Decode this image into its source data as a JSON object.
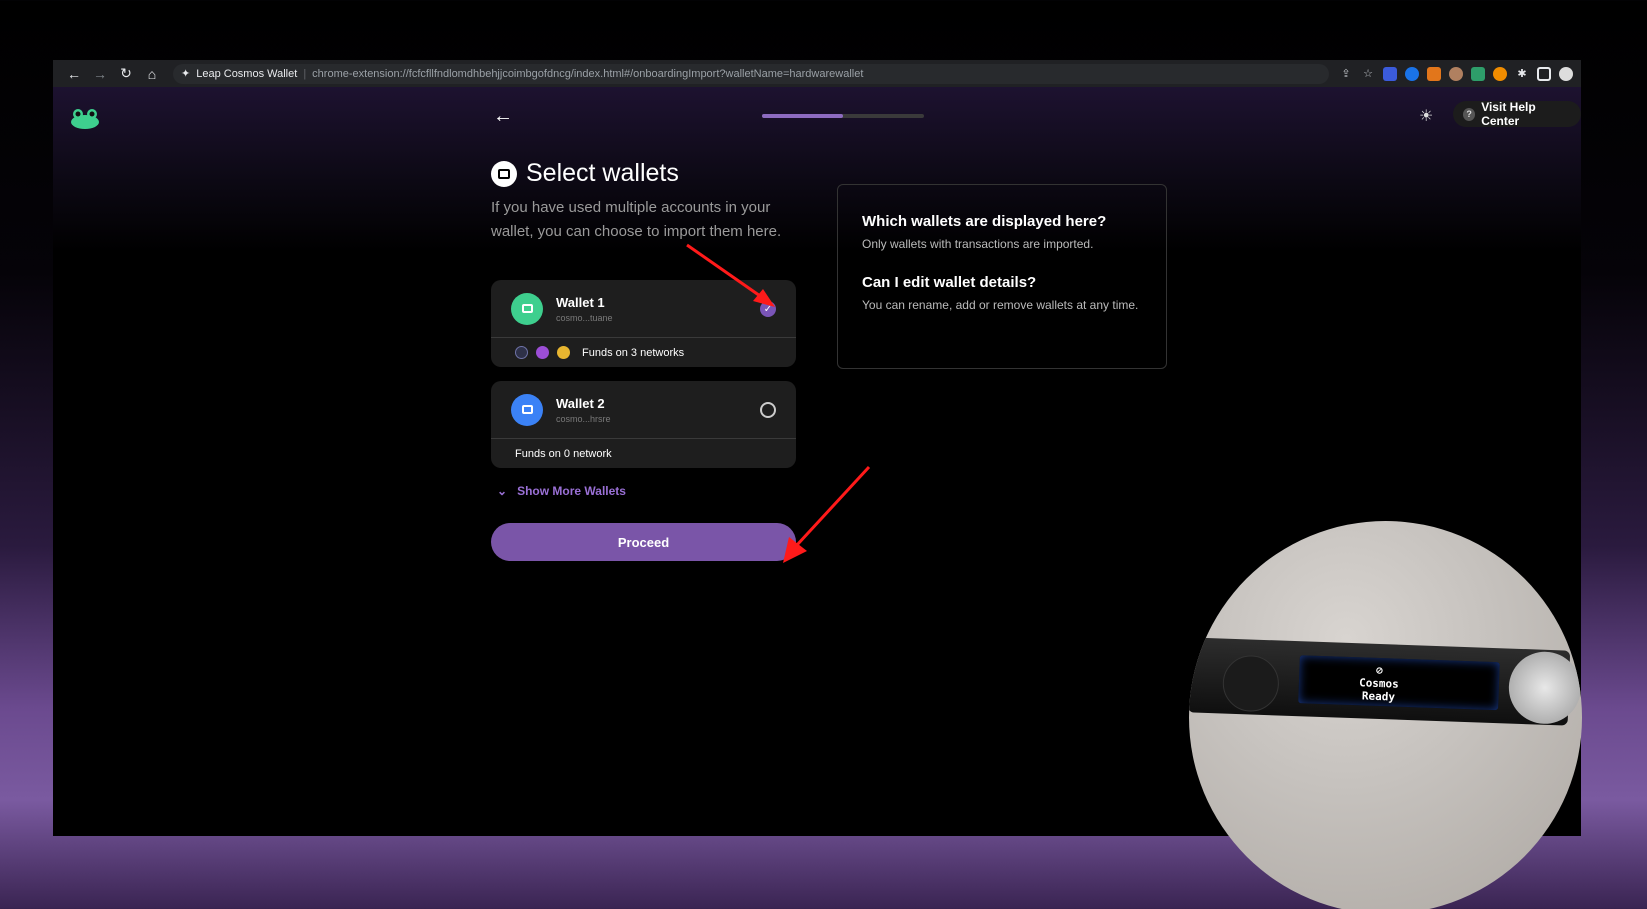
{
  "browser": {
    "site_name": "Leap Cosmos Wallet",
    "url": "chrome-extension://fcfcfllfndlomdhbehjjcoimbgofdncg/index.html#/onboardingImport?walletName=hardwarewallet"
  },
  "header": {
    "help_label": "Visit Help Center",
    "progress": 0.5
  },
  "main": {
    "title": "Select wallets",
    "subtitle": "If you have used multiple accounts in your wallet, you can choose to import them here.",
    "wallets": [
      {
        "name": "Wallet 1",
        "address": "cosmo...tuane",
        "funds": "Funds on 3 networks",
        "selected": true,
        "color": "#3ecf8e"
      },
      {
        "name": "Wallet 2",
        "address": "cosmo...hrsre",
        "funds": "Funds on 0 network",
        "selected": false,
        "color": "#3b82f6"
      }
    ],
    "show_more_label": "Show More Wallets",
    "proceed_label": "Proceed"
  },
  "faq": [
    {
      "question": "Which wallets are displayed here?",
      "answer": "Only wallets with transactions are imported."
    },
    {
      "question": "Can I edit wallet details?",
      "answer": "You can rename, add or remove wallets at any time."
    }
  ],
  "device": {
    "screen_line1": "Cosmos",
    "screen_line2": "Ready"
  },
  "colors": {
    "accent": "#7a55a8",
    "link": "#9a70d6",
    "annotation": "#ff1a1a"
  }
}
